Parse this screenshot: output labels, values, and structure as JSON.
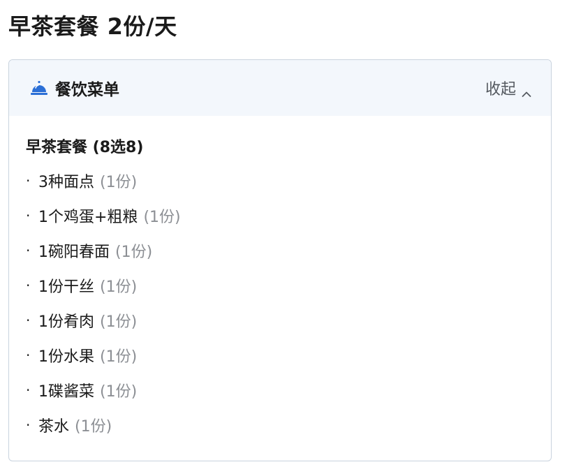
{
  "page": {
    "title": "早茶套餐 2份/天"
  },
  "menu": {
    "header_title": "餐饮菜单",
    "header_icon": "service-bell-icon",
    "collapse_label": "收起",
    "collapse_icon": "chevron-up-icon",
    "accent_color": "#2b6fd6",
    "section_title": "早茶套餐 (8选8)",
    "bullet": "·",
    "items": [
      {
        "name": "3种面点",
        "qty": "(1份)"
      },
      {
        "name": "1个鸡蛋+粗粮",
        "qty": "(1份)"
      },
      {
        "name": "1碗阳春面",
        "qty": "(1份)"
      },
      {
        "name": "1份干丝",
        "qty": "(1份)"
      },
      {
        "name": "1份肴肉",
        "qty": "(1份)"
      },
      {
        "name": "1份水果",
        "qty": "(1份)"
      },
      {
        "name": "1碟酱菜",
        "qty": "(1份)"
      },
      {
        "name": "茶水",
        "qty": "(1份)"
      }
    ]
  }
}
